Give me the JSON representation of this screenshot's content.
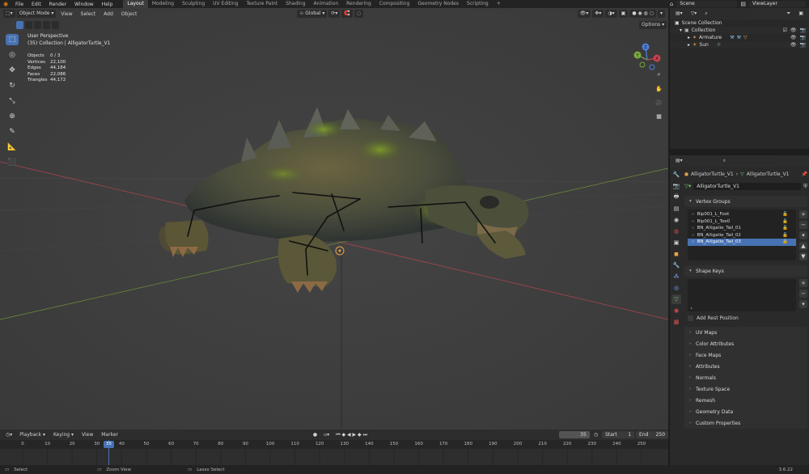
{
  "topbar": {
    "menus": [
      "File",
      "Edit",
      "Render",
      "Window",
      "Help"
    ],
    "workspaces": [
      "Layout",
      "Modeling",
      "Sculpting",
      "UV Editing",
      "Texture Paint",
      "Shading",
      "Animation",
      "Rendering",
      "Compositing",
      "Geometry Nodes",
      "Scripting"
    ],
    "active_workspace": "Layout",
    "add_tab": "+",
    "scene": "Scene",
    "view_layer": "ViewLayer"
  },
  "viewport": {
    "mode": "Object Mode",
    "menus": [
      "View",
      "Select",
      "Add",
      "Object"
    ],
    "transform_orientation": "Global",
    "options_label": "Options",
    "view_name": "User Perspective",
    "collection_info": "(35) Collection | AlligatorTurtle_V1",
    "stats": [
      {
        "label": "Objects",
        "value": "0 / 3"
      },
      {
        "label": "Vertices",
        "value": "22,100"
      },
      {
        "label": "Edges",
        "value": "44,184"
      },
      {
        "label": "Faces",
        "value": "22,086"
      },
      {
        "label": "Triangles",
        "value": "44,172"
      }
    ],
    "gizmo": {
      "x": "X",
      "y": "Y",
      "z": "Z"
    },
    "tools": [
      "select-box-icon",
      "cursor-icon",
      "move-icon",
      "rotate-icon",
      "scale-icon",
      "transform-icon",
      "annotate-icon",
      "measure-icon",
      "add-cube-icon"
    ]
  },
  "outliner": {
    "root": "Scene Collection",
    "collection": "Collection",
    "items": [
      {
        "name": "Armature",
        "icon": "armature-icon"
      },
      {
        "name": "Sun",
        "icon": "light-icon"
      }
    ]
  },
  "properties": {
    "breadcrumb_object": "AlligatorTurtle_V1",
    "breadcrumb_data": "AlligatorTurtle_V1",
    "mesh_name": "AlligatorTurtle_V1",
    "vertex_groups_title": "Vertex Groups",
    "vertex_groups": [
      "Bip001_L_Foot",
      "Bip001_L_Toe0",
      "BN_Alligatie_Tail_01",
      "BN_Alligatie_Tail_02",
      "BN_Alligatie_Tail_03"
    ],
    "selected_group_index": 4,
    "shape_keys_title": "Shape Keys",
    "add_rest_position": "Add Rest Position",
    "collapsed_panels": [
      "UV Maps",
      "Color Attributes",
      "Face Maps",
      "Attributes",
      "Normals",
      "Texture Space",
      "Remesh",
      "Geometry Data",
      "Custom Properties"
    ]
  },
  "timeline": {
    "menus": [
      "Playback",
      "Keying",
      "View",
      "Marker"
    ],
    "current_frame": "35",
    "start_label": "Start",
    "start": "1",
    "end_label": "End",
    "end": "250",
    "ticks": [
      "0",
      "10",
      "20",
      "30",
      "40",
      "50",
      "60",
      "70",
      "80",
      "90",
      "100",
      "110",
      "120",
      "130",
      "140",
      "150",
      "160",
      "170",
      "180",
      "190",
      "200",
      "210",
      "220",
      "230",
      "240",
      "250"
    ]
  },
  "statusbar": {
    "select": "Select",
    "zoom": "Zoom View",
    "lasso": "Lasso Select",
    "version": "3.6.22"
  },
  "colors": {
    "accent": "#4772b3",
    "x_axis": "#c8424f",
    "y_axis": "#7ba83f",
    "z_axis": "#4f7fd9"
  }
}
